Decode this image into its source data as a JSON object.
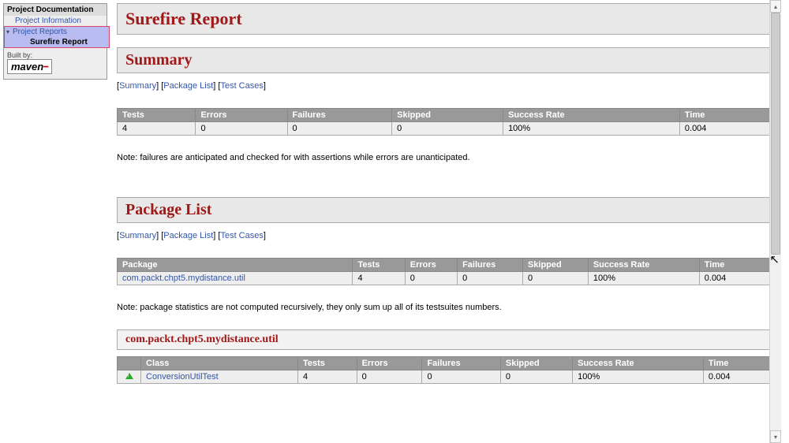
{
  "sidebar": {
    "header": "Project Documentation",
    "item1": "Project Information",
    "item2": "Project Reports",
    "item3": "Surefire Report",
    "footer_label": "Built by:",
    "maven_text": "maven"
  },
  "main": {
    "title": "Surefire Report",
    "summary_heading": "Summary",
    "nav": {
      "a": "Summary",
      "b": "Package List",
      "c": "Test Cases"
    },
    "summary_table": {
      "headers": {
        "tests": "Tests",
        "errors": "Errors",
        "failures": "Failures",
        "skipped": "Skipped",
        "rate": "Success Rate",
        "time": "Time"
      },
      "row": {
        "tests": "4",
        "errors": "0",
        "failures": "0",
        "skipped": "0",
        "rate": "100%",
        "time": "0.004"
      }
    },
    "summary_note": "Note: failures are anticipated and checked for with assertions while errors are unanticipated.",
    "packages_heading": "Package List",
    "packages_table": {
      "headers": {
        "pkg": "Package",
        "tests": "Tests",
        "errors": "Errors",
        "failures": "Failures",
        "skipped": "Skipped",
        "rate": "Success Rate",
        "time": "Time"
      },
      "row": {
        "pkg": "com.packt.chpt5.mydistance.util",
        "tests": "4",
        "errors": "0",
        "failures": "0",
        "skipped": "0",
        "rate": "100%",
        "time": "0.004"
      }
    },
    "packages_note": "Note: package statistics are not computed recursively, they only sum up all of its testsuites numbers.",
    "package_detail_heading": "com.packt.chpt5.mydistance.util",
    "class_table": {
      "headers": {
        "blank": "",
        "cls": "Class",
        "tests": "Tests",
        "errors": "Errors",
        "failures": "Failures",
        "skipped": "Skipped",
        "rate": "Success Rate",
        "time": "Time"
      },
      "row": {
        "cls": "ConversionUtilTest",
        "tests": "4",
        "errors": "0",
        "failures": "0",
        "skipped": "0",
        "rate": "100%",
        "time": "0.004"
      }
    }
  }
}
